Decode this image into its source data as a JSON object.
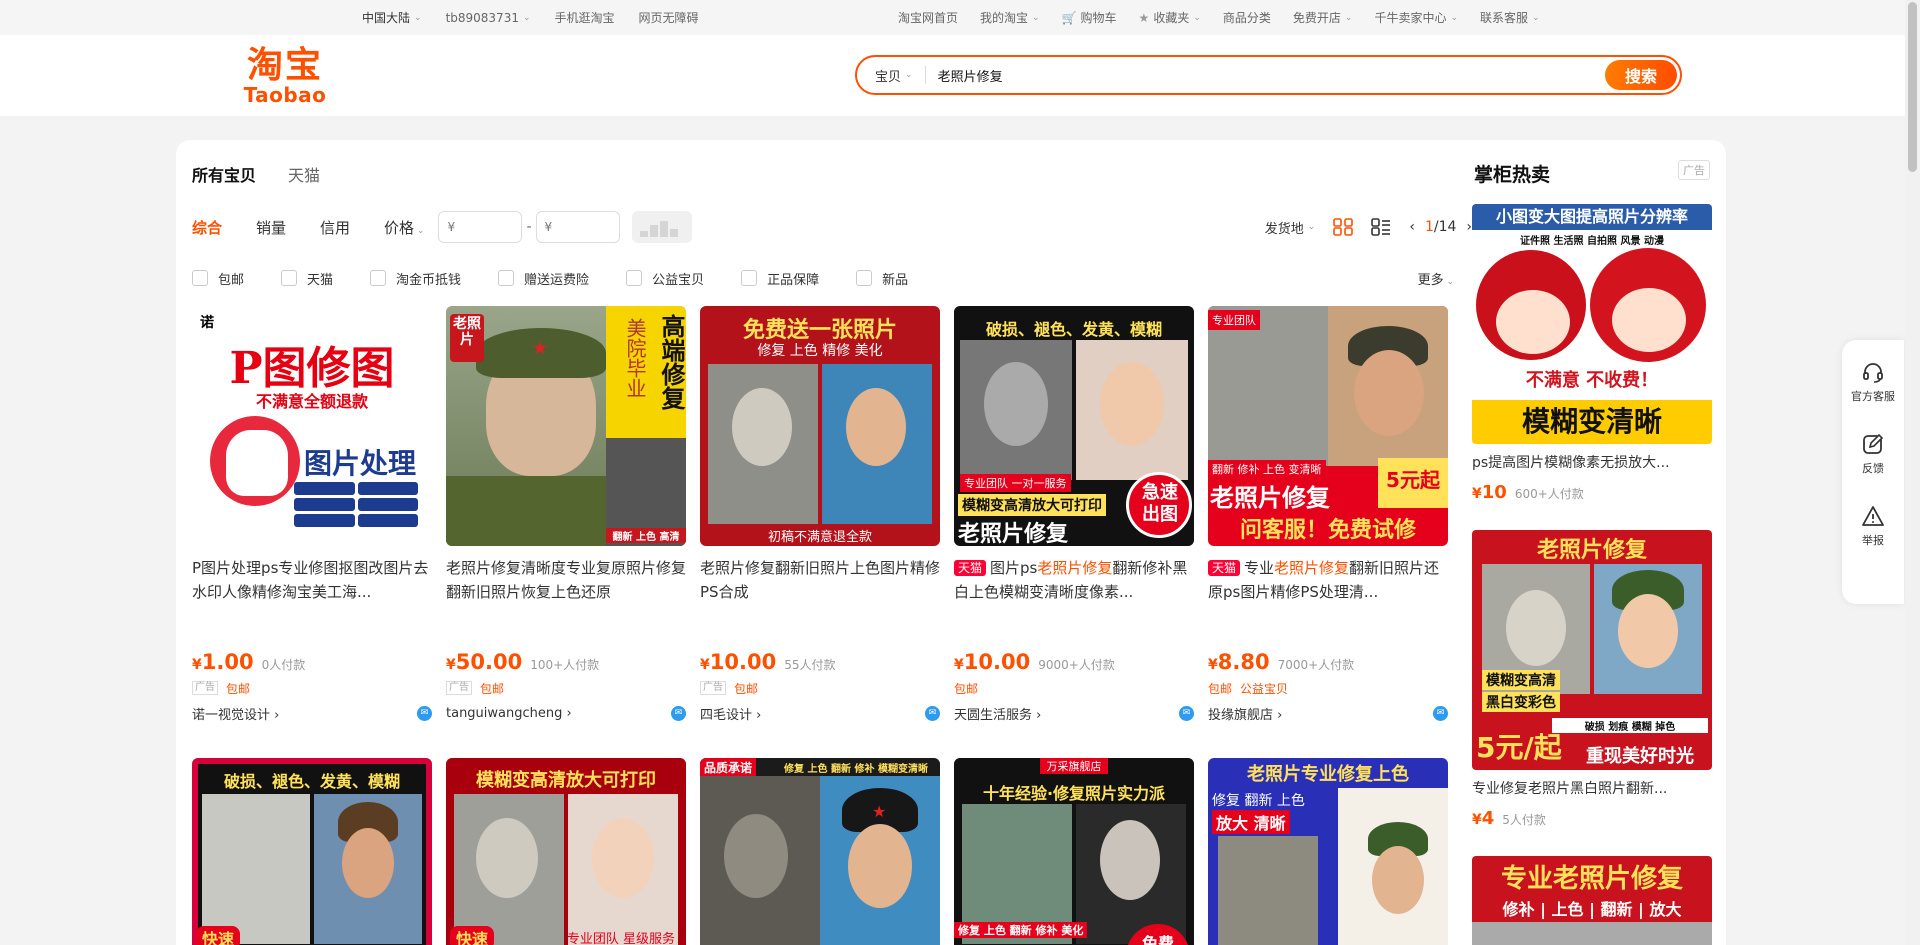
{
  "topbar": {
    "region": "中国大陆",
    "username": "tb89083731",
    "mobile": "手机逛淘宝",
    "accessible": "网页无障碍",
    "home": "淘宝网首页",
    "my_taobao": "我的淘宝",
    "cart": "购物车",
    "favorites": "收藏夹",
    "categories": "商品分类",
    "open_shop": "免费开店",
    "seller_center": "千牛卖家中心",
    "service": "联系客服"
  },
  "logo": {
    "cn": "淘宝",
    "en": "Taobao"
  },
  "search": {
    "type": "宝贝",
    "query": "老照片修复",
    "button": "搜索"
  },
  "tabs": [
    "所有宝贝",
    "天猫"
  ],
  "sort": {
    "items": [
      "综合",
      "销量",
      "信用",
      "价格"
    ],
    "price_min": "¥",
    "price_max": "¥",
    "price_dash": "-",
    "ship_from": "发货地",
    "page_current": "1",
    "page_total": "/14"
  },
  "filters": [
    "包邮",
    "天猫",
    "淘金币抵钱",
    "赠送运费险",
    "公益宝贝",
    "正品保障",
    "新品"
  ],
  "more": "更多",
  "products": [
    {
      "title": "P图片处理ps专业修图抠图改图片去水印人像精修淘宝美工海...",
      "price": "1.00",
      "paid": "0人付款",
      "tags": [
        "包邮"
      ],
      "ad": "广告",
      "shop": "诺一视觉设计",
      "img": {
        "l1": "P图修图",
        "l2": "不满意全额退款",
        "l3": "图片处理",
        "brand": "诺"
      }
    },
    {
      "title": "老照片修复清晰度专业复原照片修复翻新旧照片恢复上色还原",
      "price": "50.00",
      "paid": "100+人付款",
      "tags": [
        "包邮"
      ],
      "ad": "广告",
      "shop": "tanguiwangcheng",
      "img": {
        "l1": "高端修复",
        "l2": "美院毕业",
        "l3": "老照片",
        "l4": "翻新 上色 高清"
      }
    },
    {
      "title": "老照片修复翻新旧照片上色图片精修PS合成",
      "price": "10.00",
      "paid": "55人付款",
      "tags": [
        "包邮"
      ],
      "ad": "广告",
      "shop": "四毛设计",
      "img": {
        "l1": "免费送一张照片",
        "l2": "修复 上色 精修 美化",
        "l3": "初稿不满意退全款"
      }
    },
    {
      "title_pre": "图片ps",
      "title_hl": "老照片修复",
      "title_post": "翻新修补黑白上色模糊变清晰度像素...",
      "tmall": "天猫",
      "price": "10.00",
      "paid": "9000+人付款",
      "tags": [
        "包邮"
      ],
      "shop": "天圆生活服务",
      "img": {
        "l1": "破损、褪色、发黄、模糊",
        "l2": "专业团队 一对一服务",
        "l3": "模糊变高清放大可打印",
        "l4": "老照片修复",
        "l5": "急速出图"
      }
    },
    {
      "title_pre": "专业",
      "title_hl": "老照片修复",
      "title_post": "翻新旧照片还原ps图片精修PS处理清...",
      "tmall": "天猫",
      "price": "8.80",
      "paid": "7000+人付款",
      "tags": [
        "包邮",
        "公益宝贝"
      ],
      "shop": "投缘旗舰店",
      "img": {
        "l1": "专业团队",
        "l2": "翻新 修补 上色 变清晰",
        "l3": "老照片修复",
        "l4": "问客服！免费试修",
        "l5": "5元起"
      }
    }
  ],
  "row2": [
    {
      "l1": "破损、褪色、发黄、模糊",
      "l2": "快速"
    },
    {
      "l1": "模糊变高清放大可打印",
      "l2": "专业团队 星级服务",
      "l3": "快速"
    },
    {
      "l1": "品质承诺",
      "l2": "修复 上色 翻新 修补 模糊变清晰"
    },
    {
      "l1": "万采旗舰店",
      "l2": "十年经验·修复照片实力派",
      "l3": "修复 上色 翻新 修补 美化",
      "l4": "免费"
    },
    {
      "l1": "老照片专业修复上色",
      "l2": "修复 翻新 上色",
      "l3": "放大 清晰"
    }
  ],
  "sidebar": {
    "title": "掌柜热卖",
    "ad": "广告",
    "items": [
      {
        "title": "ps提高图片模糊像素无损放大...",
        "price": "10",
        "paid": "600+人付款",
        "img": {
          "l1": "小图变大图提高照片分辨率",
          "l2": "证件照 生活照 自拍照 风景 动漫",
          "l3": "不满意 不收费！",
          "l4": "模糊变清晰"
        }
      },
      {
        "title": "专业修复老照片黑白照片翻新...",
        "price": "4",
        "paid": "5人付款",
        "img": {
          "l1": "老照片修复",
          "l2": "模糊变高清",
          "l3": "黑白变彩色",
          "l4": "破损 划痕 模糊 掉色",
          "l5": "5元/起",
          "l6": "重现美好时光"
        }
      },
      {
        "img": {
          "l1": "专业老照片修复",
          "l2": "修补 | 上色 | 翻新 | 放大"
        }
      }
    ]
  },
  "floater": {
    "service": "官方客服",
    "feedback": "反馈",
    "report": "举报"
  },
  "colors": {
    "accent": "#ff5000",
    "tmall": "#ff0036"
  }
}
